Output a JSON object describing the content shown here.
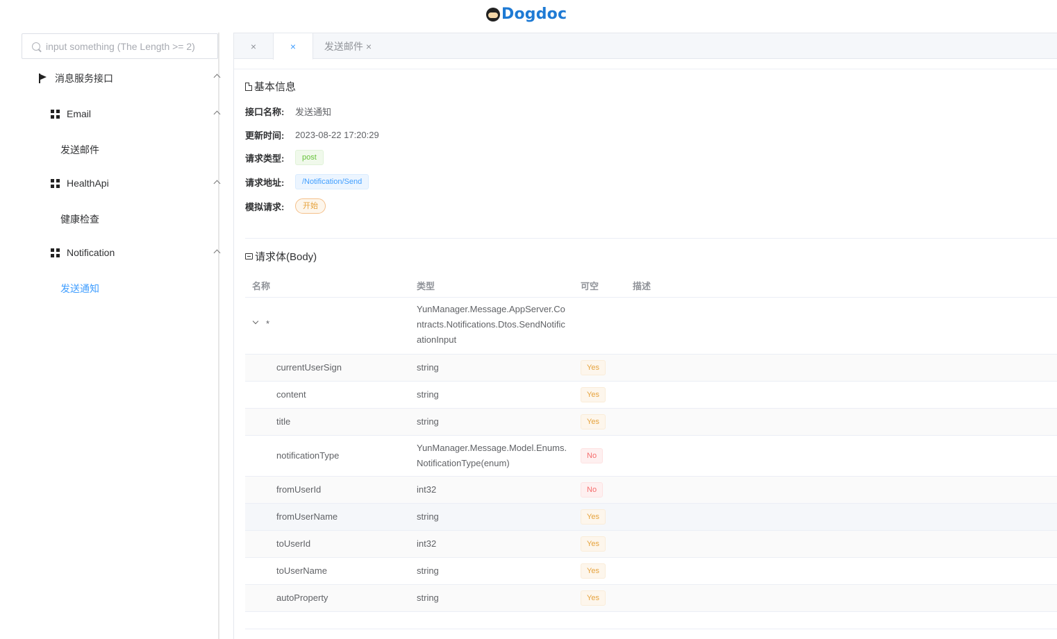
{
  "app": {
    "title": "Dogdoc"
  },
  "search": {
    "placeholder": "input something (The Length >= 2)"
  },
  "sidebar": {
    "group": {
      "label": "消息服务接口"
    },
    "sections": [
      {
        "label": "Email",
        "items": [
          {
            "label": "发送邮件"
          }
        ]
      },
      {
        "label": "HealthApi",
        "items": [
          {
            "label": "健康检查"
          }
        ]
      },
      {
        "label": "Notification",
        "items": [
          {
            "label": "发送通知",
            "active": true
          }
        ]
      }
    ]
  },
  "tabs": [
    {
      "label": "",
      "close": "×"
    },
    {
      "label": "",
      "close": "×",
      "active": true
    },
    {
      "label": "发送邮件",
      "close": "×"
    }
  ],
  "basic": {
    "title": "基本信息",
    "name_label": "接口名称:",
    "name_value": "发送通知",
    "updated_label": "更新时间:",
    "updated_value": "2023-08-22 17:20:29",
    "method_label": "请求类型:",
    "method_value": "post",
    "url_label": "请求地址:",
    "url_value": "/Notification/Send",
    "mock_label": "模拟请求:",
    "mock_button": "开始"
  },
  "body": {
    "title": "请求体(Body)",
    "columns": {
      "name": "名称",
      "type": "类型",
      "nullable": "可空",
      "desc": "描述"
    },
    "root": {
      "name": "*",
      "type": "YunManager.Message.AppServer.Contracts.Notifications.Dtos.SendNotificationInput"
    },
    "rows": [
      {
        "name": "currentUserSign",
        "type": "string",
        "nullable": "Yes"
      },
      {
        "name": "content",
        "type": "string",
        "nullable": "Yes"
      },
      {
        "name": "title",
        "type": "string",
        "nullable": "Yes"
      },
      {
        "name": "notificationType",
        "type": "YunManager.Message.Model.Enums.NotificationType(enum)",
        "nullable": "No"
      },
      {
        "name": "fromUserId",
        "type": "int32",
        "nullable": "No"
      },
      {
        "name": "fromUserName",
        "type": "string",
        "nullable": "Yes"
      },
      {
        "name": "toUserId",
        "type": "int32",
        "nullable": "Yes"
      },
      {
        "name": "toUserName",
        "type": "string",
        "nullable": "Yes"
      },
      {
        "name": "autoProperty",
        "type": "string",
        "nullable": "Yes"
      }
    ]
  }
}
